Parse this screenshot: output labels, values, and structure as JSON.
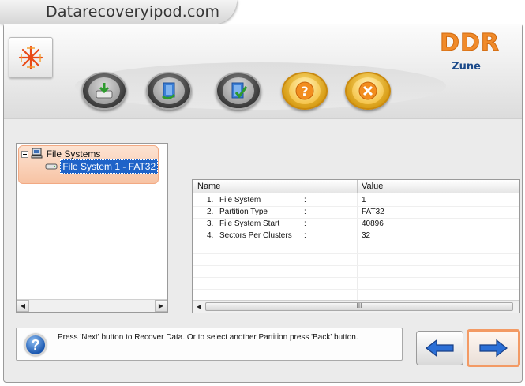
{
  "watermark": {
    "text": "Datarecoveryipod.com"
  },
  "header": {
    "brand": "DDR",
    "subtitle": "Zune"
  },
  "toolbar": {
    "buttons": [
      {
        "name": "open-drive-button",
        "icon": "drive-download-icon"
      },
      {
        "name": "load-button",
        "icon": "load-arrow-icon"
      },
      {
        "name": "save-button",
        "icon": "save-check-icon"
      },
      {
        "name": "help-button",
        "icon": "question-icon"
      },
      {
        "name": "exit-button",
        "icon": "close-icon"
      }
    ]
  },
  "tree": {
    "root": "File Systems",
    "child": "File System 1 - FAT32"
  },
  "list": {
    "columns": {
      "name": "Name",
      "value": "Value"
    },
    "rows": [
      {
        "num": "1.",
        "name": "File System",
        "sep": ":",
        "value": "1"
      },
      {
        "num": "2.",
        "name": "Partition Type",
        "sep": ":",
        "value": "FAT32"
      },
      {
        "num": "3.",
        "name": "File System Start",
        "sep": ":",
        "value": "40896"
      },
      {
        "num": "4.",
        "name": "Sectors Per Clusters",
        "sep": ":",
        "value": "32"
      }
    ],
    "scroll_grip": "III"
  },
  "status": {
    "text": "Press 'Next' button to Recover Data. Or to select another Partition press 'Back' button.",
    "help_glyph": "?"
  },
  "colors": {
    "brand": "#f08a2a",
    "selection": "#1f63c8",
    "highlight": "#f7c3a4",
    "nav_arrow": "#2b6fd6"
  }
}
